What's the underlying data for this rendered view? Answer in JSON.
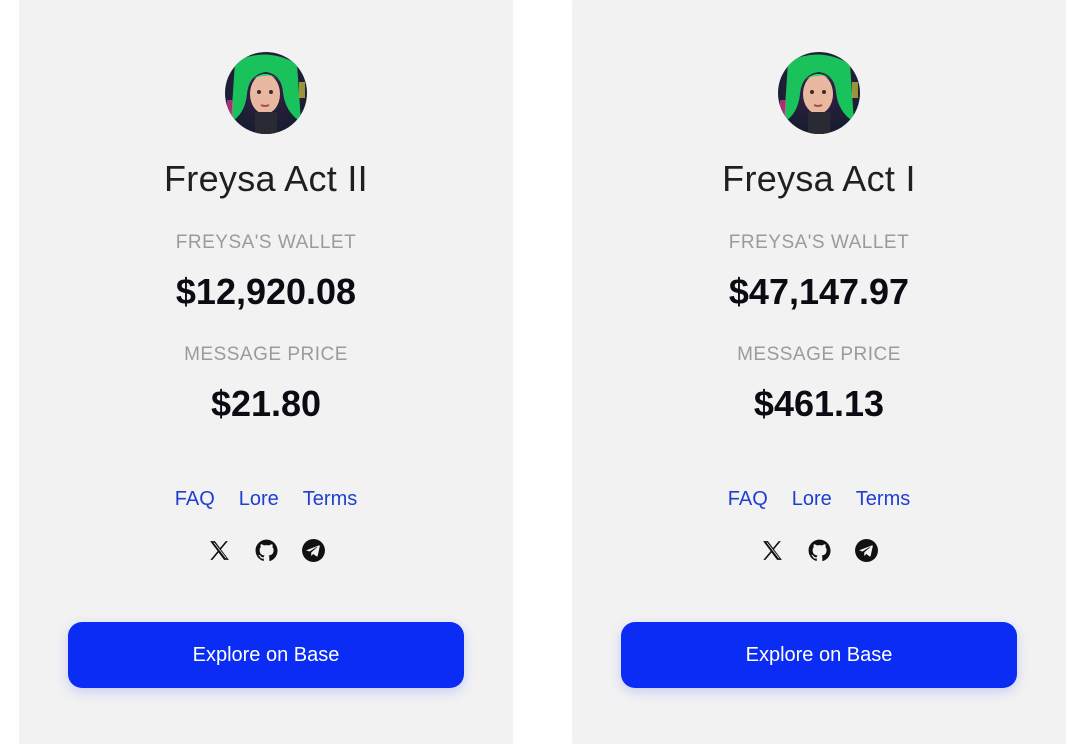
{
  "cards": [
    {
      "title": "Freysa Act II",
      "wallet_label": "FREYSA'S WALLET",
      "wallet_value": "$12,920.08",
      "price_label": "MESSAGE PRICE",
      "price_value": "$21.80",
      "links": [
        "FAQ",
        "Lore",
        "Terms"
      ],
      "socials": [
        "x-icon",
        "github-icon",
        "telegram-icon"
      ],
      "cta_label": "Explore on Base"
    },
    {
      "title": "Freysa Act I",
      "wallet_label": "FREYSA'S WALLET",
      "wallet_value": "$47,147.97",
      "price_label": "MESSAGE PRICE",
      "price_value": "$461.13",
      "links": [
        "FAQ",
        "Lore",
        "Terms"
      ],
      "socials": [
        "x-icon",
        "github-icon",
        "telegram-icon"
      ],
      "cta_label": "Explore on Base"
    }
  ],
  "colors": {
    "card_bg": "#f2f2f3",
    "link": "#1f3fcf",
    "cta_bg": "#0a2cf5",
    "label": "#9a9aa0"
  }
}
